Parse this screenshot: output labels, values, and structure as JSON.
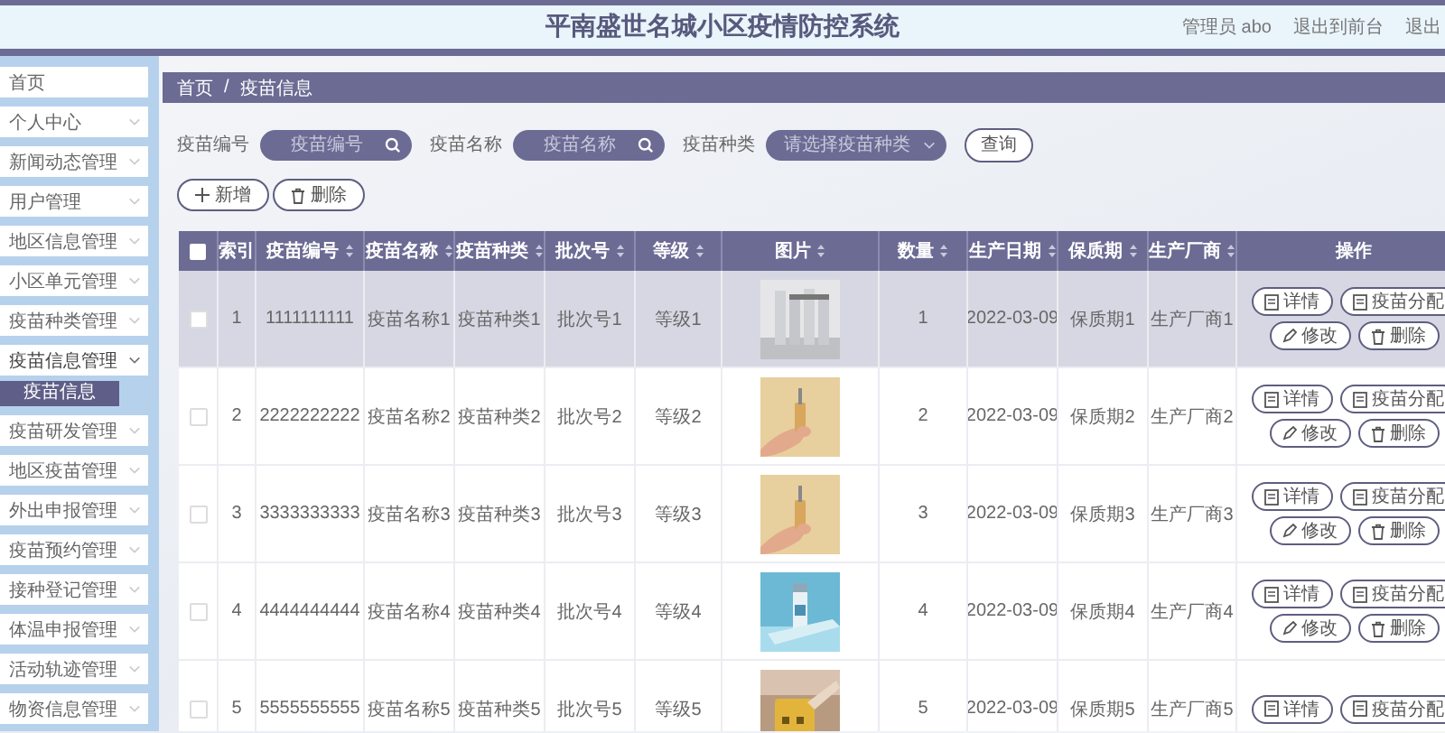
{
  "header": {
    "title": "平南盛世名城小区疫情防控系统",
    "links": [
      "管理员 abo",
      "退出到前台",
      "退出"
    ]
  },
  "sidebar": {
    "items": [
      {
        "kind": "link",
        "label": "首页"
      },
      {
        "kind": "group",
        "label": "个人中心",
        "expanded": false
      },
      {
        "kind": "group",
        "label": "新闻动态管理",
        "expanded": false
      },
      {
        "kind": "group",
        "label": "用户管理",
        "expanded": false
      },
      {
        "kind": "group",
        "label": "地区信息管理",
        "expanded": false
      },
      {
        "kind": "group",
        "label": "小区单元管理",
        "expanded": false
      },
      {
        "kind": "group",
        "label": "疫苗种类管理",
        "expanded": false
      },
      {
        "kind": "group",
        "label": "疫苗信息管理",
        "expanded": true,
        "children": [
          {
            "label": "疫苗信息",
            "selected": true
          }
        ]
      },
      {
        "kind": "group",
        "label": "疫苗研发管理",
        "expanded": false
      },
      {
        "kind": "group",
        "label": "地区疫苗管理",
        "expanded": false
      },
      {
        "kind": "group",
        "label": "外出申报管理",
        "expanded": false
      },
      {
        "kind": "group",
        "label": "疫苗预约管理",
        "expanded": false
      },
      {
        "kind": "group",
        "label": "接种登记管理",
        "expanded": false
      },
      {
        "kind": "group",
        "label": "体温申报管理",
        "expanded": false
      },
      {
        "kind": "group",
        "label": "活动轨迹管理",
        "expanded": false
      },
      {
        "kind": "group",
        "label": "物资信息管理",
        "expanded": false
      }
    ]
  },
  "breadcrumb": [
    "首页",
    "/",
    "疫苗信息"
  ],
  "search": {
    "fields": [
      {
        "kind": "text",
        "label": "疫苗编号",
        "placeholder": "疫苗编号"
      },
      {
        "kind": "text",
        "label": "疫苗名称",
        "placeholder": "疫苗名称"
      },
      {
        "kind": "select",
        "label": "疫苗种类",
        "placeholder": "请选择疫苗种类"
      }
    ],
    "button": "查询"
  },
  "toolbar": [
    {
      "kind": "add",
      "label": "新增"
    },
    {
      "kind": "delete",
      "label": "删除"
    }
  ],
  "table": {
    "all_checked": false,
    "columns": [
      {
        "label": "索引",
        "sortable": false
      },
      {
        "label": "疫苗编号",
        "sortable": true
      },
      {
        "label": "疫苗名称",
        "sortable": true
      },
      {
        "label": "疫苗种类",
        "sortable": true
      },
      {
        "label": "批次号",
        "sortable": true
      },
      {
        "label": "等级",
        "sortable": true
      },
      {
        "label": "图片",
        "sortable": true
      },
      {
        "label": "数量",
        "sortable": true
      },
      {
        "label": "生产日期",
        "sortable": true
      },
      {
        "label": "保质期",
        "sortable": true
      },
      {
        "label": "生产厂商",
        "sortable": true
      },
      {
        "label": "操作",
        "sortable": false
      }
    ],
    "rows": [
      {
        "hovered": true,
        "checked": false,
        "cells": [
          "1",
          "1111111111",
          "疫苗名称1",
          "疫苗种类1",
          "批次号1",
          "等级1"
        ],
        "image": {
          "kind": "picture"
        },
        "cells2": [
          "1",
          "2022-03-09",
          "保质期1",
          "生产厂商1"
        ],
        "actions": [
          {
            "kind": "detail",
            "label": "详情"
          },
          {
            "kind": "assign",
            "label": "疫苗分配"
          },
          {
            "kind": "edit",
            "label": "修改"
          },
          {
            "kind": "delete",
            "label": "删除"
          }
        ]
      },
      {
        "hovered": false,
        "checked": false,
        "cells": [
          "2",
          "2222222222",
          "疫苗名称2",
          "疫苗种类2",
          "批次号2",
          "等级2"
        ],
        "image": {
          "kind": "picture"
        },
        "cells2": [
          "2",
          "2022-03-09",
          "保质期2",
          "生产厂商2"
        ],
        "actions": [
          {
            "kind": "detail",
            "label": "详情"
          },
          {
            "kind": "assign",
            "label": "疫苗分配"
          },
          {
            "kind": "edit",
            "label": "修改"
          },
          {
            "kind": "delete",
            "label": "删除"
          }
        ]
      },
      {
        "hovered": false,
        "checked": false,
        "cells": [
          "3",
          "3333333333",
          "疫苗名称3",
          "疫苗种类3",
          "批次号3",
          "等级3"
        ],
        "image": {
          "kind": "picture"
        },
        "cells2": [
          "3",
          "2022-03-09",
          "保质期3",
          "生产厂商3"
        ],
        "actions": [
          {
            "kind": "detail",
            "label": "详情"
          },
          {
            "kind": "assign",
            "label": "疫苗分配"
          },
          {
            "kind": "edit",
            "label": "修改"
          },
          {
            "kind": "delete",
            "label": "删除"
          }
        ]
      },
      {
        "hovered": false,
        "checked": false,
        "cells": [
          "4",
          "4444444444",
          "疫苗名称4",
          "疫苗种类4",
          "批次号4",
          "等级4"
        ],
        "image": {
          "kind": "picture"
        },
        "cells2": [
          "4",
          "2022-03-09",
          "保质期4",
          "生产厂商4"
        ],
        "actions": [
          {
            "kind": "detail",
            "label": "详情"
          },
          {
            "kind": "assign",
            "label": "疫苗分配"
          },
          {
            "kind": "edit",
            "label": "修改"
          },
          {
            "kind": "delete",
            "label": "删除"
          }
        ]
      },
      {
        "hovered": false,
        "checked": false,
        "cells": [
          "5",
          "5555555555",
          "疫苗名称5",
          "疫苗种类5",
          "批次号5",
          "等级5"
        ],
        "image": {
          "kind": "picture"
        },
        "cells2": [
          "5",
          "2022-03-09",
          "保质期5",
          "生产厂商5"
        ],
        "actions": [
          {
            "kind": "detail",
            "label": "详情"
          },
          {
            "kind": "assign",
            "label": "疫苗分配"
          }
        ]
      }
    ]
  }
}
